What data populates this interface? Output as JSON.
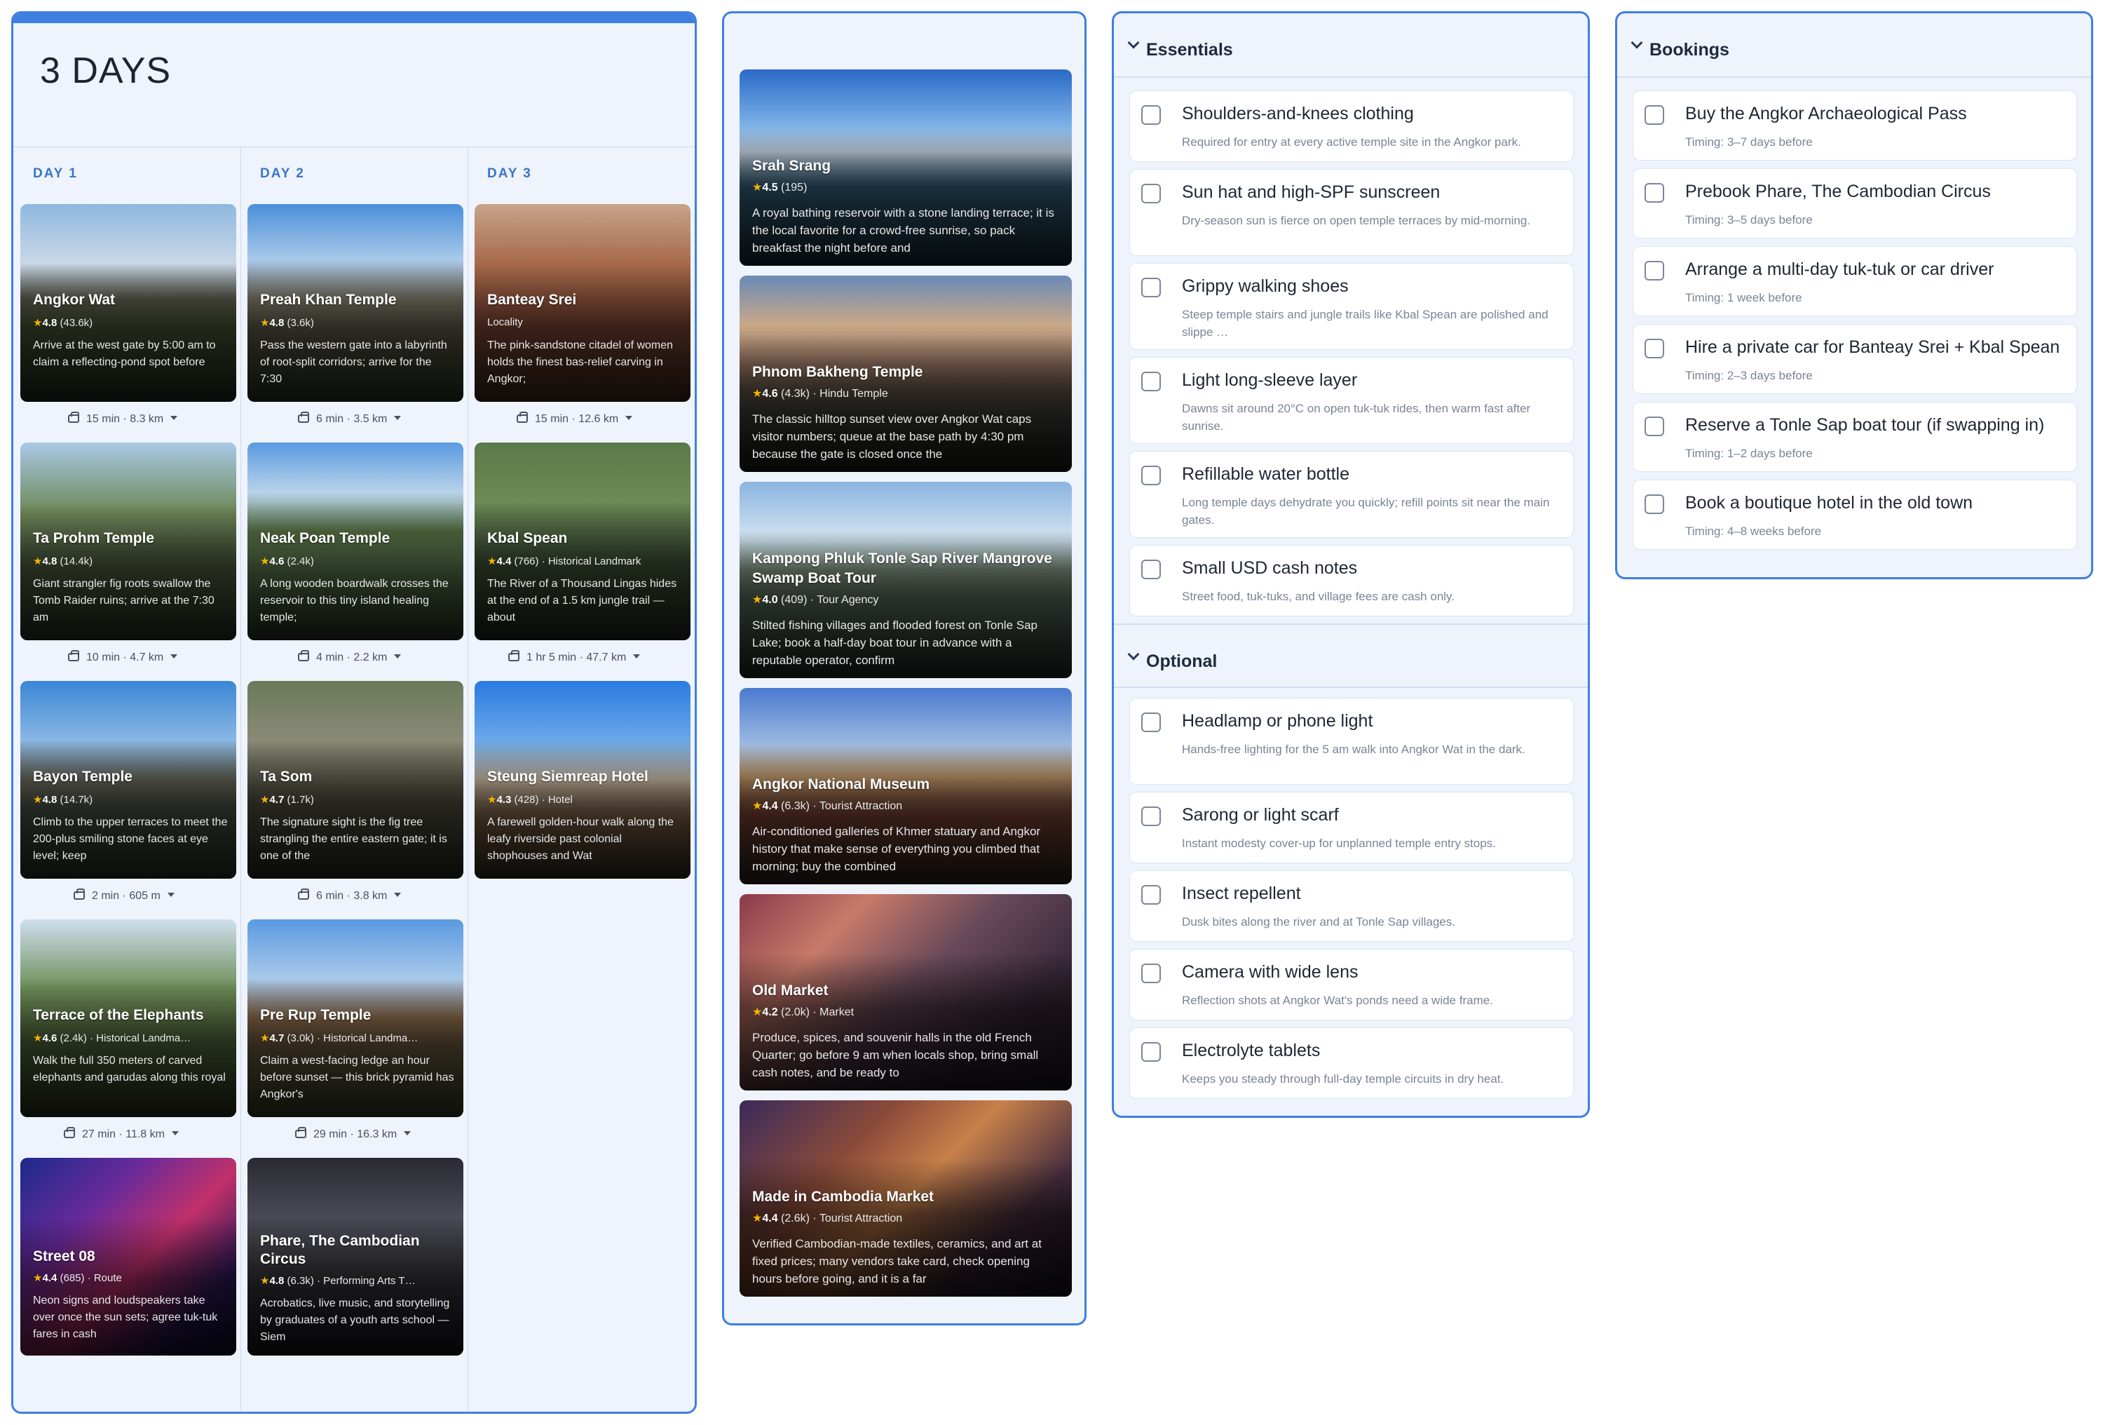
{
  "itinerary": {
    "title": "3 DAYS",
    "days": [
      {
        "label": "DAY 1",
        "stops": [
          {
            "name": "Angkor Wat",
            "rating": "4.8",
            "reviews": "(43.6k)",
            "category": "",
            "desc": "Arrive at the west gate by 5:00 am to claim a reflecting-pond spot before",
            "travel": "15 min · 8.3 km"
          },
          {
            "name": "Ta Prohm Temple",
            "rating": "4.8",
            "reviews": "(14.4k)",
            "category": "",
            "desc": "Giant strangler fig roots swallow the Tomb Raider ruins; arrive at the 7:30 am",
            "travel": "10 min · 4.7 km"
          },
          {
            "name": "Bayon Temple",
            "rating": "4.8",
            "reviews": "(14.7k)",
            "category": "",
            "desc": "Climb to the upper terraces to meet the 200-plus smiling stone faces at eye level; keep",
            "travel": "2 min · 605 m"
          },
          {
            "name": "Terrace of the Elephants",
            "rating": "4.6",
            "reviews": "(2.4k)",
            "category": "· Historical Landma…",
            "desc": "Walk the full 350 meters of carved elephants and garudas along this royal",
            "travel": "27 min · 11.8 km"
          },
          {
            "name": "Street 08",
            "rating": "4.4",
            "reviews": "(685)",
            "category": "· Route",
            "desc": "Neon signs and loudspeakers take over once the sun sets; agree tuk-tuk fares in cash",
            "travel": ""
          }
        ]
      },
      {
        "label": "DAY 2",
        "stops": [
          {
            "name": "Preah Khan Temple",
            "rating": "4.8",
            "reviews": "(3.6k)",
            "category": "",
            "desc": "Pass the western gate into a labyrinth of root-split corridors; arrive for the 7:30",
            "travel": "6 min · 3.5 km"
          },
          {
            "name": "Neak Poan Temple",
            "rating": "4.6",
            "reviews": "(2.4k)",
            "category": "",
            "desc": "A long wooden boardwalk crosses the reservoir to this tiny island healing temple;",
            "travel": "4 min · 2.2 km"
          },
          {
            "name": "Ta Som",
            "rating": "4.7",
            "reviews": "(1.7k)",
            "category": "",
            "desc": "The signature sight is the fig tree strangling the entire eastern gate; it is one of the",
            "travel": "6 min · 3.8 km"
          },
          {
            "name": "Pre Rup Temple",
            "rating": "4.7",
            "reviews": "(3.0k)",
            "category": "· Historical Landma…",
            "desc": "Claim a west-facing ledge an hour before sunset — this brick pyramid has Angkor's",
            "travel": "29 min · 16.3 km"
          },
          {
            "name": "Phare, The Cambodian Circus",
            "rating": "4.8",
            "reviews": "(6.3k)",
            "category": "· Performing Arts T…",
            "desc": "Acrobatics, live music, and storytelling by graduates of a youth arts school — Siem",
            "travel": ""
          }
        ]
      },
      {
        "label": "DAY 3",
        "stops": [
          {
            "name": "Banteay Srei",
            "rating": "",
            "reviews": "",
            "category": "Locality",
            "desc": "The pink-sandstone citadel of women holds the finest bas-relief carving in Angkor;",
            "travel": "15 min · 12.6 km"
          },
          {
            "name": "Kbal Spean",
            "rating": "4.4",
            "reviews": "(766)",
            "category": "· Historical Landmark",
            "desc": "The River of a Thousand Lingas hides at the end of a 1.5 km jungle trail — about",
            "travel": "1 hr 5 min · 47.7 km"
          },
          {
            "name": "Steung Siemreap Hotel",
            "rating": "4.3",
            "reviews": "(428)",
            "category": "· Hotel",
            "desc": "A farewell golden-hour walk along the leafy riverside past colonial shophouses and Wat",
            "travel": ""
          }
        ]
      }
    ]
  },
  "saved": [
    {
      "name": "Srah Srang",
      "rating": "4.5",
      "reviews": "(195)",
      "category": "",
      "desc": "A royal bathing reservoir with a stone landing terrace; it is the local favorite for a crowd-free sunrise, so pack breakfast the night before and"
    },
    {
      "name": "Phnom Bakheng Temple",
      "rating": "4.6",
      "reviews": "(4.3k)",
      "category": "· Hindu Temple",
      "desc": "The classic hilltop sunset view over Angkor Wat caps visitor numbers; queue at the base path by 4:30 pm because the gate is closed once the"
    },
    {
      "name": "Kampong Phluk Tonle Sap River Mangrove Swamp Boat Tour",
      "rating": "4.0",
      "reviews": "(409)",
      "category": "· Tour Agency",
      "desc": "Stilted fishing villages and flooded forest on Tonle Sap Lake; book a half-day boat tour in advance with a reputable operator, confirm"
    },
    {
      "name": "Angkor National Museum",
      "rating": "4.4",
      "reviews": "(6.3k)",
      "category": "· Tourist Attraction",
      "desc": "Air-conditioned galleries of Khmer statuary and Angkor history that make sense of everything you climbed that morning; buy the combined"
    },
    {
      "name": "Old Market",
      "rating": "4.2",
      "reviews": "(2.0k)",
      "category": "· Market",
      "desc": "Produce, spices, and souvenir halls in the old French Quarter; go before 9 am when locals shop, bring small cash notes, and be ready to"
    },
    {
      "name": "Made in Cambodia Market",
      "rating": "4.4",
      "reviews": "(2.6k)",
      "category": "· Tourist Attraction",
      "desc": "Verified Cambodian-made textiles, ceramics, and art at fixed prices; many vendors take card, check opening hours before going, and it is a far"
    }
  ],
  "packing": {
    "essentials_label": "Essentials",
    "essentials": [
      {
        "title": "Shoulders-and-knees clothing",
        "note": "Required for entry at every active temple site in the Angkor park."
      },
      {
        "title": "Sun hat and high-SPF sunscreen",
        "note": "Dry-season sun is fierce on open temple terraces by mid-morning."
      },
      {
        "title": "Grippy walking shoes",
        "note": "Steep temple stairs and jungle trails like Kbal Spean are polished and slippe …"
      },
      {
        "title": "Light long-sleeve layer",
        "note": "Dawns sit around 20°C on open tuk-tuk rides, then warm fast after sunrise."
      },
      {
        "title": "Refillable water bottle",
        "note": "Long temple days dehydrate you quickly; refill points sit near the main gates."
      },
      {
        "title": "Small USD cash notes",
        "note": "Street food, tuk-tuks, and village fees are cash only."
      }
    ],
    "optional_label": "Optional",
    "optional": [
      {
        "title": "Headlamp or phone light",
        "note": "Hands-free lighting for the 5 am walk into Angkor Wat in the dark."
      },
      {
        "title": "Sarong or light scarf",
        "note": "Instant modesty cover-up for unplanned temple entry stops."
      },
      {
        "title": "Insect repellent",
        "note": "Dusk bites along the river and at Tonle Sap villages."
      },
      {
        "title": "Camera with wide lens",
        "note": "Reflection shots at Angkor Wat's ponds need a wide frame."
      },
      {
        "title": "Electrolyte tablets",
        "note": "Keeps you steady through full-day temple circuits in dry heat."
      }
    ]
  },
  "bookings": {
    "label": "Bookings",
    "items": [
      {
        "title": "Buy the Angkor Archaeological Pass",
        "note": "Timing: 3–7 days before"
      },
      {
        "title": "Prebook Phare, The Cambodian Circus",
        "note": "Timing: 3–5 days before"
      },
      {
        "title": "Arrange a multi-day tuk-tuk or car driver",
        "note": "Timing: 1 week before"
      },
      {
        "title": "Hire a private car for Banteay Srei + Kbal Spean",
        "note": "Timing: 2–3 days before"
      },
      {
        "title": "Reserve a Tonle Sap boat tour (if swapping in)",
        "note": "Timing: 1–2 days before"
      },
      {
        "title": "Book a boutique hotel in the old town",
        "note": "Timing: 4–8 weeks before"
      }
    ]
  },
  "colors": {
    "accent": "#3f7fe0",
    "panel_bg": "#eef3fc",
    "star": "#f5b400"
  }
}
